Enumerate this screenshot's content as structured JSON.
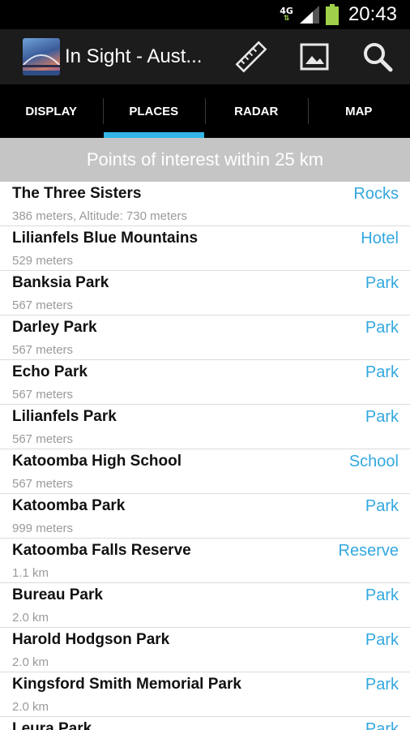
{
  "status_bar": {
    "network": "4G",
    "time": "20:43"
  },
  "action_bar": {
    "title": "In Sight - Aust...",
    "icons": [
      "ruler-icon",
      "image-icon",
      "search-icon"
    ]
  },
  "tabs": [
    {
      "label": "DISPLAY",
      "active": false
    },
    {
      "label": "PLACES",
      "active": true
    },
    {
      "label": "RADAR",
      "active": false
    },
    {
      "label": "MAP",
      "active": false
    }
  ],
  "section_header": "Points of interest within 25 km",
  "places": [
    {
      "name": "The Three Sisters",
      "distance": "386 meters, Altitude: 730 meters",
      "category": "Rocks"
    },
    {
      "name": "Lilianfels Blue Mountains",
      "distance": "529 meters",
      "category": "Hotel"
    },
    {
      "name": "Banksia Park",
      "distance": "567 meters",
      "category": "Park"
    },
    {
      "name": "Darley Park",
      "distance": "567 meters",
      "category": "Park"
    },
    {
      "name": "Echo Park",
      "distance": "567 meters",
      "category": "Park"
    },
    {
      "name": "Lilianfels Park",
      "distance": "567 meters",
      "category": "Park"
    },
    {
      "name": "Katoomba High School",
      "distance": "567 meters",
      "category": "School"
    },
    {
      "name": "Katoomba Park",
      "distance": "999 meters",
      "category": "Park"
    },
    {
      "name": "Katoomba Falls Reserve",
      "distance": "1.1 km",
      "category": "Reserve"
    },
    {
      "name": "Bureau Park",
      "distance": "2.0 km",
      "category": "Park"
    },
    {
      "name": "Harold Hodgson Park",
      "distance": "2.0 km",
      "category": "Park"
    },
    {
      "name": "Kingsford Smith Memorial Park",
      "distance": "2.0 km",
      "category": "Park"
    },
    {
      "name": "Leura Park",
      "distance": "",
      "category": "Park"
    }
  ],
  "colors": {
    "accent": "#33b5e5",
    "category_text": "#33a8e0",
    "header_bg": "#c5c5c5"
  }
}
